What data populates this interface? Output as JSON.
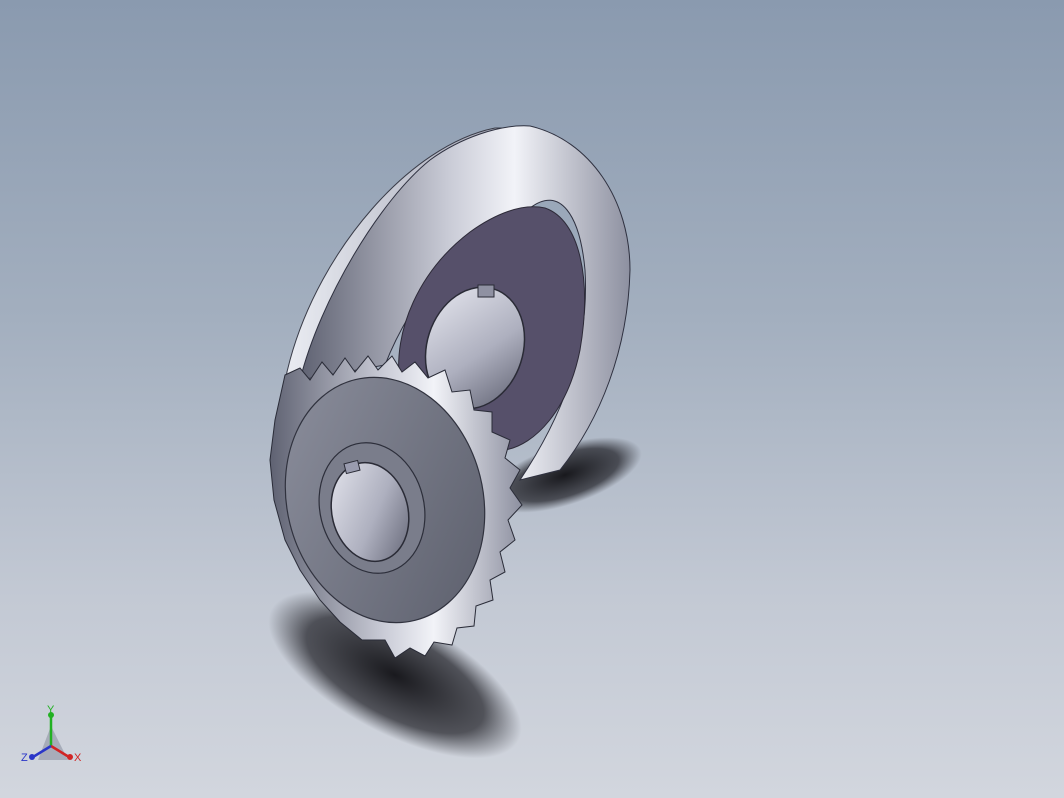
{
  "viewport": {
    "background_top": "#8a9aaf",
    "background_bottom": "#d2d6de",
    "model": {
      "description_name": "bevel-gear-pair",
      "large_gear_color": "#56506a",
      "small_gear_color": "#6c6f7c",
      "bore_color": "#b6b8c6"
    }
  },
  "triad": {
    "x_label": "X",
    "y_label": "Y",
    "z_label": "Z",
    "x_color": "#d12424",
    "y_color": "#22b122",
    "z_color": "#2a36c8"
  }
}
